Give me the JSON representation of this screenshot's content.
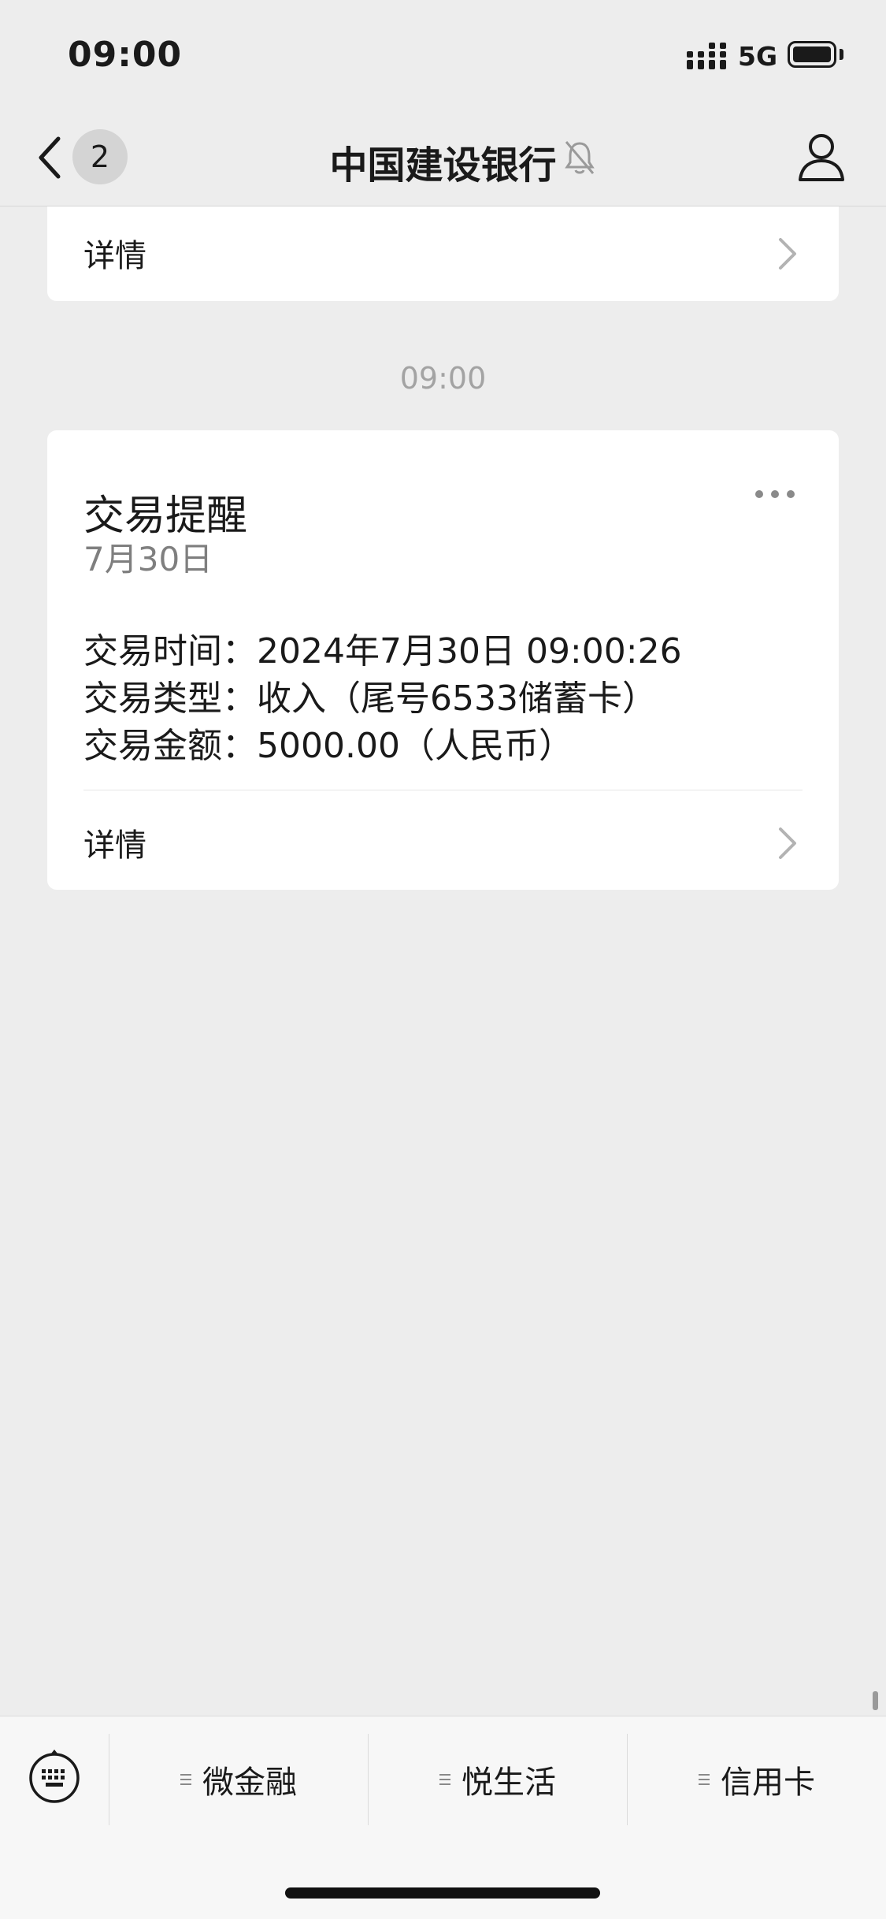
{
  "status_bar": {
    "time": "09:00",
    "network": "5G",
    "battery_level": 1.0
  },
  "nav": {
    "unread_count": "2",
    "title": "中国建设银行"
  },
  "previous_card": {
    "detail_label": "详情"
  },
  "message_time": "09:00",
  "card": {
    "title": "交易提醒",
    "date": "7月30日",
    "fields": [
      {
        "key": "交易时间：",
        "value": "2024年7月30日 09:00:26"
      },
      {
        "key": "交易类型：",
        "value": "收入（尾号6533储蓄卡）"
      },
      {
        "key": "交易金额：",
        "value": "5000.00（人民币）"
      }
    ],
    "detail_label": "详情"
  },
  "bottom_menu": {
    "items": [
      {
        "label": "微金融"
      },
      {
        "label": "悦生活"
      },
      {
        "label": "信用卡"
      }
    ]
  },
  "icons": {
    "back": "chevron-left-icon",
    "mute": "bell-slash-icon",
    "profile": "person-icon",
    "more": "ellipsis-icon",
    "detail": "chevron-right-icon",
    "keyboard": "keyboard-icon",
    "menu": "menu-lines-icon"
  }
}
